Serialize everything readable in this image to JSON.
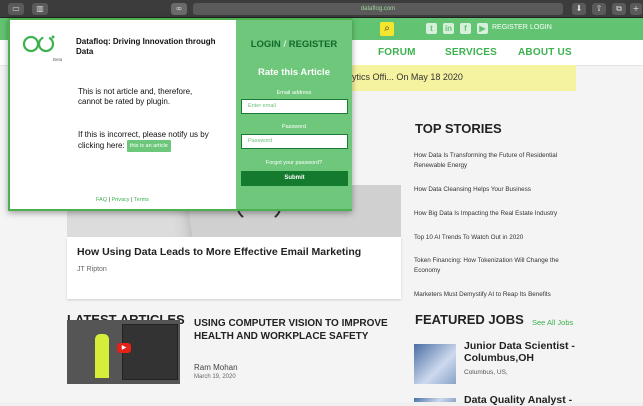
{
  "browser": {
    "url": "dataflog.com",
    "icons": [
      "sidebar-icon",
      "extension-icon",
      "download-icon",
      "share-icon",
      "tabs-icon",
      "new-tab-icon"
    ]
  },
  "site": {
    "topbar": {
      "register": "REGISTER",
      "login": "LOGIN",
      "accent": "#62c472"
    },
    "nav": [
      "FORUM",
      "SERVICES",
      "ABOUT US"
    ],
    "ticker": "ytics Offi... On May 18 2020",
    "featured_card": {
      "title": "How Using Data Leads to More Effective Email Marketing",
      "author": "JT Ripton"
    },
    "top_stories": {
      "title": "TOP STORIES",
      "items": [
        "How Data Is Transforming the Future of Residential Renewable Energy",
        "How Data Cleansing Helps Your Business",
        "How Big Data Is Impacting the Real Estate Industry",
        "Top 10 AI Trends To Watch Out in 2020",
        "Token Financing: How Tokenization Will Change the Economy",
        "Marketers Must Demystify AI to Reap Its Benefits"
      ]
    },
    "latest": {
      "title": "LATEST ARTICLES",
      "article_title": "USING COMPUTER VISION TO IMPROVE HEALTH AND WORKPLACE SAFETY",
      "author": "Ram Mohan",
      "date": "March 19, 2020"
    },
    "jobs": {
      "title": "FEATURED JOBS",
      "see_all": "See All Jobs",
      "job1_title": "Junior Data Scientist - Columbus,OH",
      "job1_location": "Columbus, US,",
      "job2_title": "Data Quality Analyst -"
    }
  },
  "popup": {
    "title": "Datafloq: Driving Innovation through Data",
    "beta": "Beta",
    "message": "This is not article and, therefore, cannot be rated by plugin.",
    "incorrect": "If this is incorrect, please notify us by clicking here:",
    "article_button": "this is an article",
    "footer": {
      "faq": "FAQ",
      "privacy": "Privacy",
      "terms": "Terms"
    },
    "login": "LOGIN",
    "register": "REGISTER",
    "rate_heading": "Rate this Article",
    "email_label": "Email address",
    "email_placeholder": "Enter email",
    "password_label": "Password",
    "password_placeholder": "Password",
    "forgot": "Forgot your password?",
    "submit": "Submit",
    "accent": "#6ec77b"
  }
}
